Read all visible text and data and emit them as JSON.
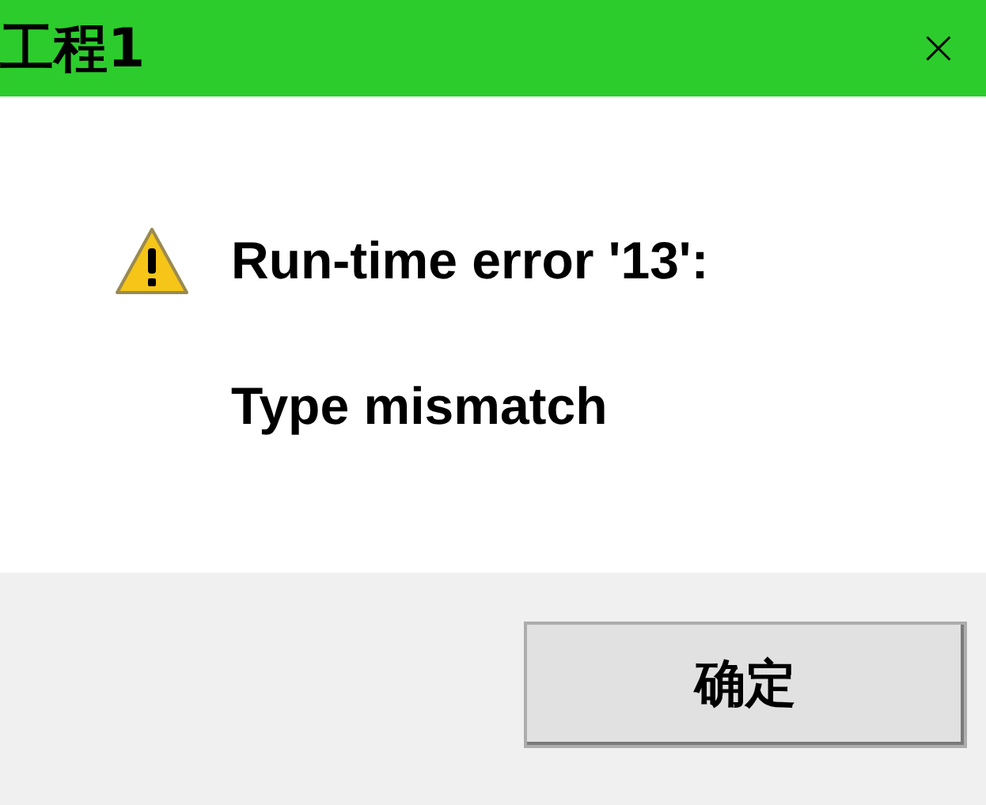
{
  "window": {
    "title": "工程1",
    "close": "×"
  },
  "message": {
    "lines": [
      "Run-time error '13':",
      "Type mismatch"
    ]
  },
  "buttons": [
    "确定"
  ]
}
